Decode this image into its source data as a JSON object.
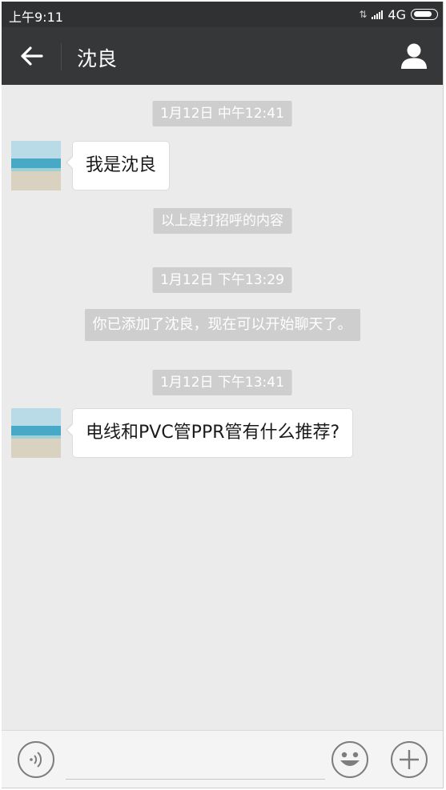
{
  "status": {
    "time": "上午9:11",
    "network": "4G"
  },
  "header": {
    "title": "沈良"
  },
  "messages": [
    {
      "kind": "timestamp",
      "text": "1月12日 中午12:41"
    },
    {
      "kind": "received",
      "text": "我是沈良"
    },
    {
      "kind": "system",
      "text": "以上是打招呼的内容"
    },
    {
      "kind": "timestamp",
      "text": "1月12日 下午13:29"
    },
    {
      "kind": "system",
      "text": "你已添加了沈良，现在可以开始聊天了。"
    },
    {
      "kind": "timestamp",
      "text": "1月12日 下午13:41"
    },
    {
      "kind": "received",
      "text": "电线和PVC管PPR管有什么推荐?"
    }
  ],
  "input": {
    "value": "",
    "placeholder": ""
  },
  "icons": {
    "back": "back-arrow-icon",
    "profile": "person-icon",
    "voice": "voice-icon",
    "emoji": "smiley-icon",
    "more": "plus-icon"
  },
  "colors": {
    "header_bg": "#353739",
    "status_bg": "#2f3133",
    "chat_bg": "#ebebeb",
    "system_pill": "#cecece",
    "bubble_bg": "#ffffff"
  }
}
